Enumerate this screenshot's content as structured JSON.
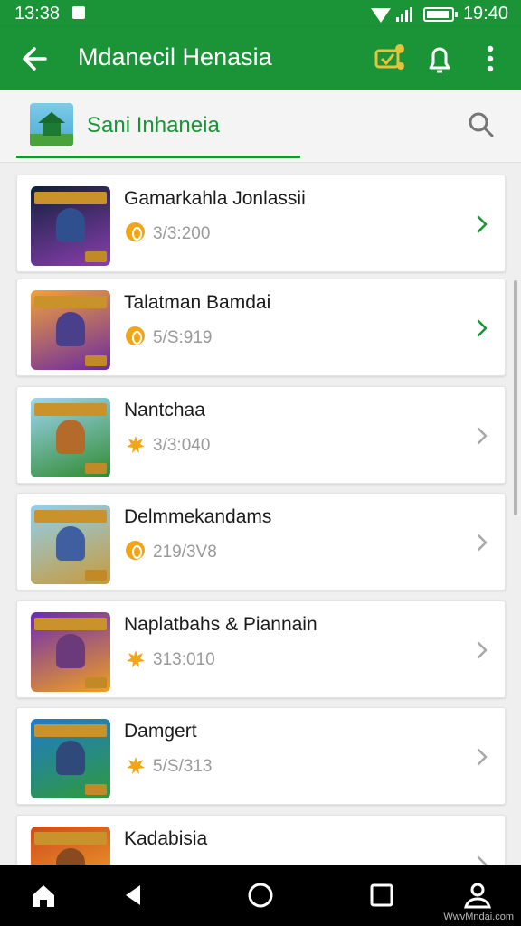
{
  "status_bar": {
    "time_left": "13:38",
    "time_right": "19:40"
  },
  "app_bar": {
    "title": "Mdanecil Henasia"
  },
  "section": {
    "title": "Sani Inhaneia"
  },
  "items": [
    {
      "name": "Gamarkahla Jonlassii",
      "meta": "3/3:200",
      "badge_icon": "coin-icon",
      "chevron_color": "#1a9437",
      "thumb_colors": [
        "#0f1f3a",
        "#8a3fb0"
      ],
      "figure_color": "#2f4f8f"
    },
    {
      "name": "Talatman Bamdai",
      "meta": "5/S:919",
      "badge_icon": "coin-icon",
      "chevron_color": "#1a9437",
      "thumb_colors": [
        "#f2a13a",
        "#6a2aa0"
      ],
      "figure_color": "#4a3f8a"
    },
    {
      "name": "Nantchaa",
      "meta": "3/3:040",
      "badge_icon": "burst-icon",
      "chevron_color": "#a8a8a8",
      "thumb_colors": [
        "#9fd5f2",
        "#2f8a2f"
      ],
      "figure_color": "#b36a2a"
    },
    {
      "name": "Delmmekandams",
      "meta": "219/3V8",
      "badge_icon": "coin-icon",
      "chevron_color": "#a8a8a8",
      "thumb_colors": [
        "#8fd0f0",
        "#c89a3a"
      ],
      "figure_color": "#3f5fa0"
    },
    {
      "name": "Naplatbahs & Piannain",
      "meta": "313:010",
      "badge_icon": "burst-icon",
      "chevron_color": "#a8a8a8",
      "thumb_colors": [
        "#6a2ab5",
        "#f0a020"
      ],
      "figure_color": "#6a3a7a"
    },
    {
      "name": "Damgert",
      "meta": "5/S/313",
      "badge_icon": "burst-icon",
      "chevron_color": "#a8a8a8",
      "thumb_colors": [
        "#1f7acc",
        "#2f9a3a"
      ],
      "figure_color": "#2f4a7a"
    },
    {
      "name": "Kadabisia",
      "meta": "",
      "badge_icon": "burst-icon",
      "chevron_color": "#a8a8a8",
      "thumb_colors": [
        "#d04a1a",
        "#f0b030"
      ],
      "figure_color": "#8a4a20"
    }
  ],
  "watermark": "WwvMndai.com",
  "colors": {
    "primary": "#1a9437",
    "badge": "#f0a618",
    "background": "#efefef"
  }
}
